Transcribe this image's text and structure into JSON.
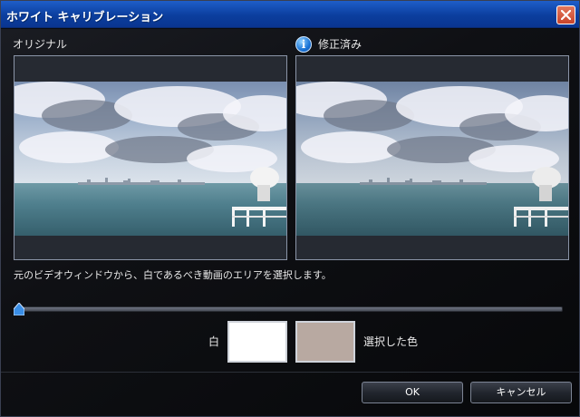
{
  "window": {
    "title": "ホワイト キャリブレーション",
    "close_icon": "close-icon"
  },
  "panes": {
    "original_label": "オリジナル",
    "corrected_label": "修正済み",
    "info_icon_glyph": "i"
  },
  "instruction": "元のビデオウィンドウから、白であるべき動画のエリアを選択します。",
  "slider": {
    "value": 0
  },
  "swatches": {
    "white_label": "白",
    "white_color": "#ffffff",
    "selected_label": "選択した色",
    "selected_color": "#b8a9a1"
  },
  "buttons": {
    "ok": "OK",
    "cancel": "キャンセル"
  },
  "colors": {
    "titlebar": "#0b3e9e",
    "background": "#0b0c0f"
  }
}
